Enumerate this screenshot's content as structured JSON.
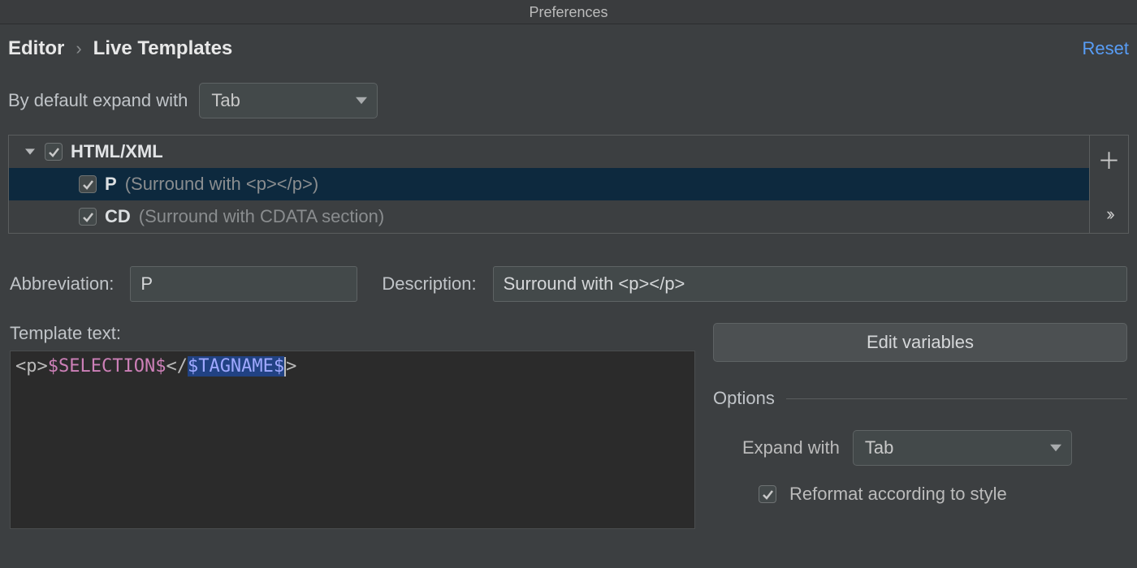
{
  "window": {
    "title": "Preferences"
  },
  "breadcrumb": {
    "root": "Editor",
    "page": "Live Templates"
  },
  "reset_label": "Reset",
  "default_expand": {
    "label": "By default expand with",
    "value": "Tab"
  },
  "tree": {
    "group": "HTML/XML",
    "items": [
      {
        "abbr": "P",
        "desc": "(Surround with <p></p>)"
      },
      {
        "abbr": "CD",
        "desc": "(Surround with CDATA section)"
      }
    ]
  },
  "fields": {
    "abbr_label": "Abbreviation:",
    "abbr_value": "P",
    "desc_label": "Description:",
    "desc_value": "Surround with <p></p>"
  },
  "template": {
    "label": "Template text:",
    "prefix": "<p>",
    "var1": "$SELECTION$",
    "mid": "</",
    "var2": "$TAGNAME$",
    "suffix": ">"
  },
  "edit_variables_label": "Edit variables",
  "options": {
    "heading": "Options",
    "expand_label": "Expand with",
    "expand_value": "Tab",
    "reformat_label": "Reformat according to style"
  }
}
